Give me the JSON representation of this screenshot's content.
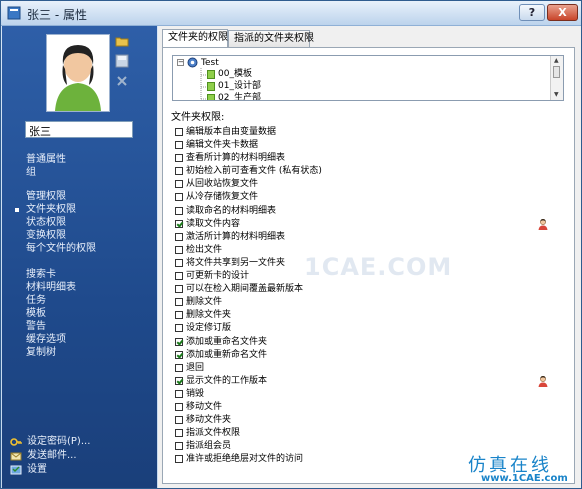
{
  "window": {
    "title": "张三 - 属性",
    "help_label": "?",
    "close_label": "X"
  },
  "sidebar": {
    "user_name": "张三",
    "nav_groups": [
      [
        "普通属性",
        "组"
      ],
      [
        "管理权限",
        "文件夹权限",
        "状态权限",
        "变换权限",
        "每个文件的权限"
      ],
      [
        "搜索卡",
        "材料明细表",
        "任务",
        "模板",
        "警告",
        "缓存选项",
        "复制树"
      ]
    ],
    "active_item": "文件夹权限",
    "bottom_links": [
      {
        "label": "设定密码(P)...",
        "icon": "key-icon"
      },
      {
        "label": "发送邮件...",
        "icon": "mail-icon"
      },
      {
        "label": "设置",
        "icon": "settings-icon"
      }
    ]
  },
  "tabs": [
    "文件夹的权限",
    "指派的文件夹权限"
  ],
  "tree": {
    "root": "Test",
    "children": [
      "00_模板",
      "01_设计部",
      "02_生产部"
    ]
  },
  "permissions_label": "文件夹权限:",
  "permissions": [
    {
      "label": "编辑版本自由变量数据",
      "checked": false
    },
    {
      "label": "编辑文件夹卡数据",
      "checked": false
    },
    {
      "label": "查看所计算的材料明细表",
      "checked": false
    },
    {
      "label": "初始检入前可查看文件 (私有状态)",
      "checked": false
    },
    {
      "label": "从回收站恢复文件",
      "checked": false
    },
    {
      "label": "从冷存储恢复文件",
      "checked": false
    },
    {
      "label": "读取命名的材料明细表",
      "checked": false
    },
    {
      "label": "读取文件内容",
      "checked": true,
      "has_user_icon": true
    },
    {
      "label": "激活所计算的材料明细表",
      "checked": false
    },
    {
      "label": "检出文件",
      "checked": false
    },
    {
      "label": "将文件共享到另一文件夹",
      "checked": false
    },
    {
      "label": "可更新卡的设计",
      "checked": false
    },
    {
      "label": "可以在检入期间覆盖最新版本",
      "checked": false
    },
    {
      "label": "删除文件",
      "checked": false
    },
    {
      "label": "删除文件夹",
      "checked": false
    },
    {
      "label": "设定修订版",
      "checked": false
    },
    {
      "label": "添加或重命名文件夹",
      "checked": true
    },
    {
      "label": "添加或重新命名文件",
      "checked": true
    },
    {
      "label": "退回",
      "checked": false
    },
    {
      "label": "显示文件的工作版本",
      "checked": true,
      "has_user_icon": true
    },
    {
      "label": "销毁",
      "checked": false
    },
    {
      "label": "移动文件",
      "checked": false
    },
    {
      "label": "移动文件夹",
      "checked": false
    },
    {
      "label": "指派文件权限",
      "checked": false
    },
    {
      "label": "指派组会员",
      "checked": false
    },
    {
      "label": "准许或拒绝绝层对文件的访问",
      "checked": false
    }
  ],
  "watermark": "1CAE.COM",
  "brand": {
    "cn": "仿真在线",
    "en": "www.1CAE.com"
  },
  "colors": {
    "sidebar": "#2e5fa8",
    "check": "#1a7a1a",
    "brand": "#1a84c9"
  }
}
